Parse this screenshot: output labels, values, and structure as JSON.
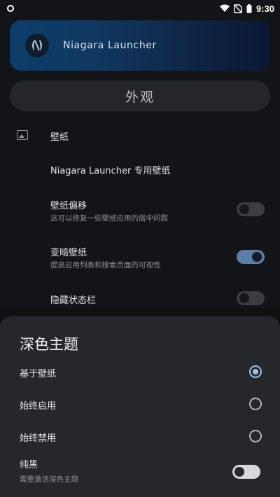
{
  "status_bar": {
    "time": "9:30"
  },
  "banner": {
    "title": "Niagara Launcher"
  },
  "section": {
    "title": "外观"
  },
  "settings": {
    "wallpaper_header": "壁纸",
    "niagara_wallpaper": "Niagara Launcher 专用壁纸",
    "wallpaper_offset": {
      "title": "壁纸偏移",
      "subtitle": "这可以修复一些壁纸应用的居中问题",
      "enabled": false
    },
    "dim_wallpaper": {
      "title": "变暗壁纸",
      "subtitle": "提高应用列表和搜索页面的可视性",
      "enabled": true
    },
    "hide_status_bar": {
      "title": "隐藏状态栏",
      "enabled": false
    }
  },
  "dark_theme_sheet": {
    "title": "深色主题",
    "options": [
      {
        "label": "基于壁纸",
        "selected": true
      },
      {
        "label": "始终启用",
        "selected": false
      },
      {
        "label": "始终禁用",
        "selected": false
      }
    ],
    "pure_black": {
      "title": "纯黑",
      "subtitle": "需要激活深色主题",
      "enabled": false
    }
  },
  "colors": {
    "background": "#131417",
    "sheet": "#26272b",
    "accent": "#9ec2ea",
    "banner_start": "#0d3e6b",
    "banner_end": "#0a1733"
  }
}
